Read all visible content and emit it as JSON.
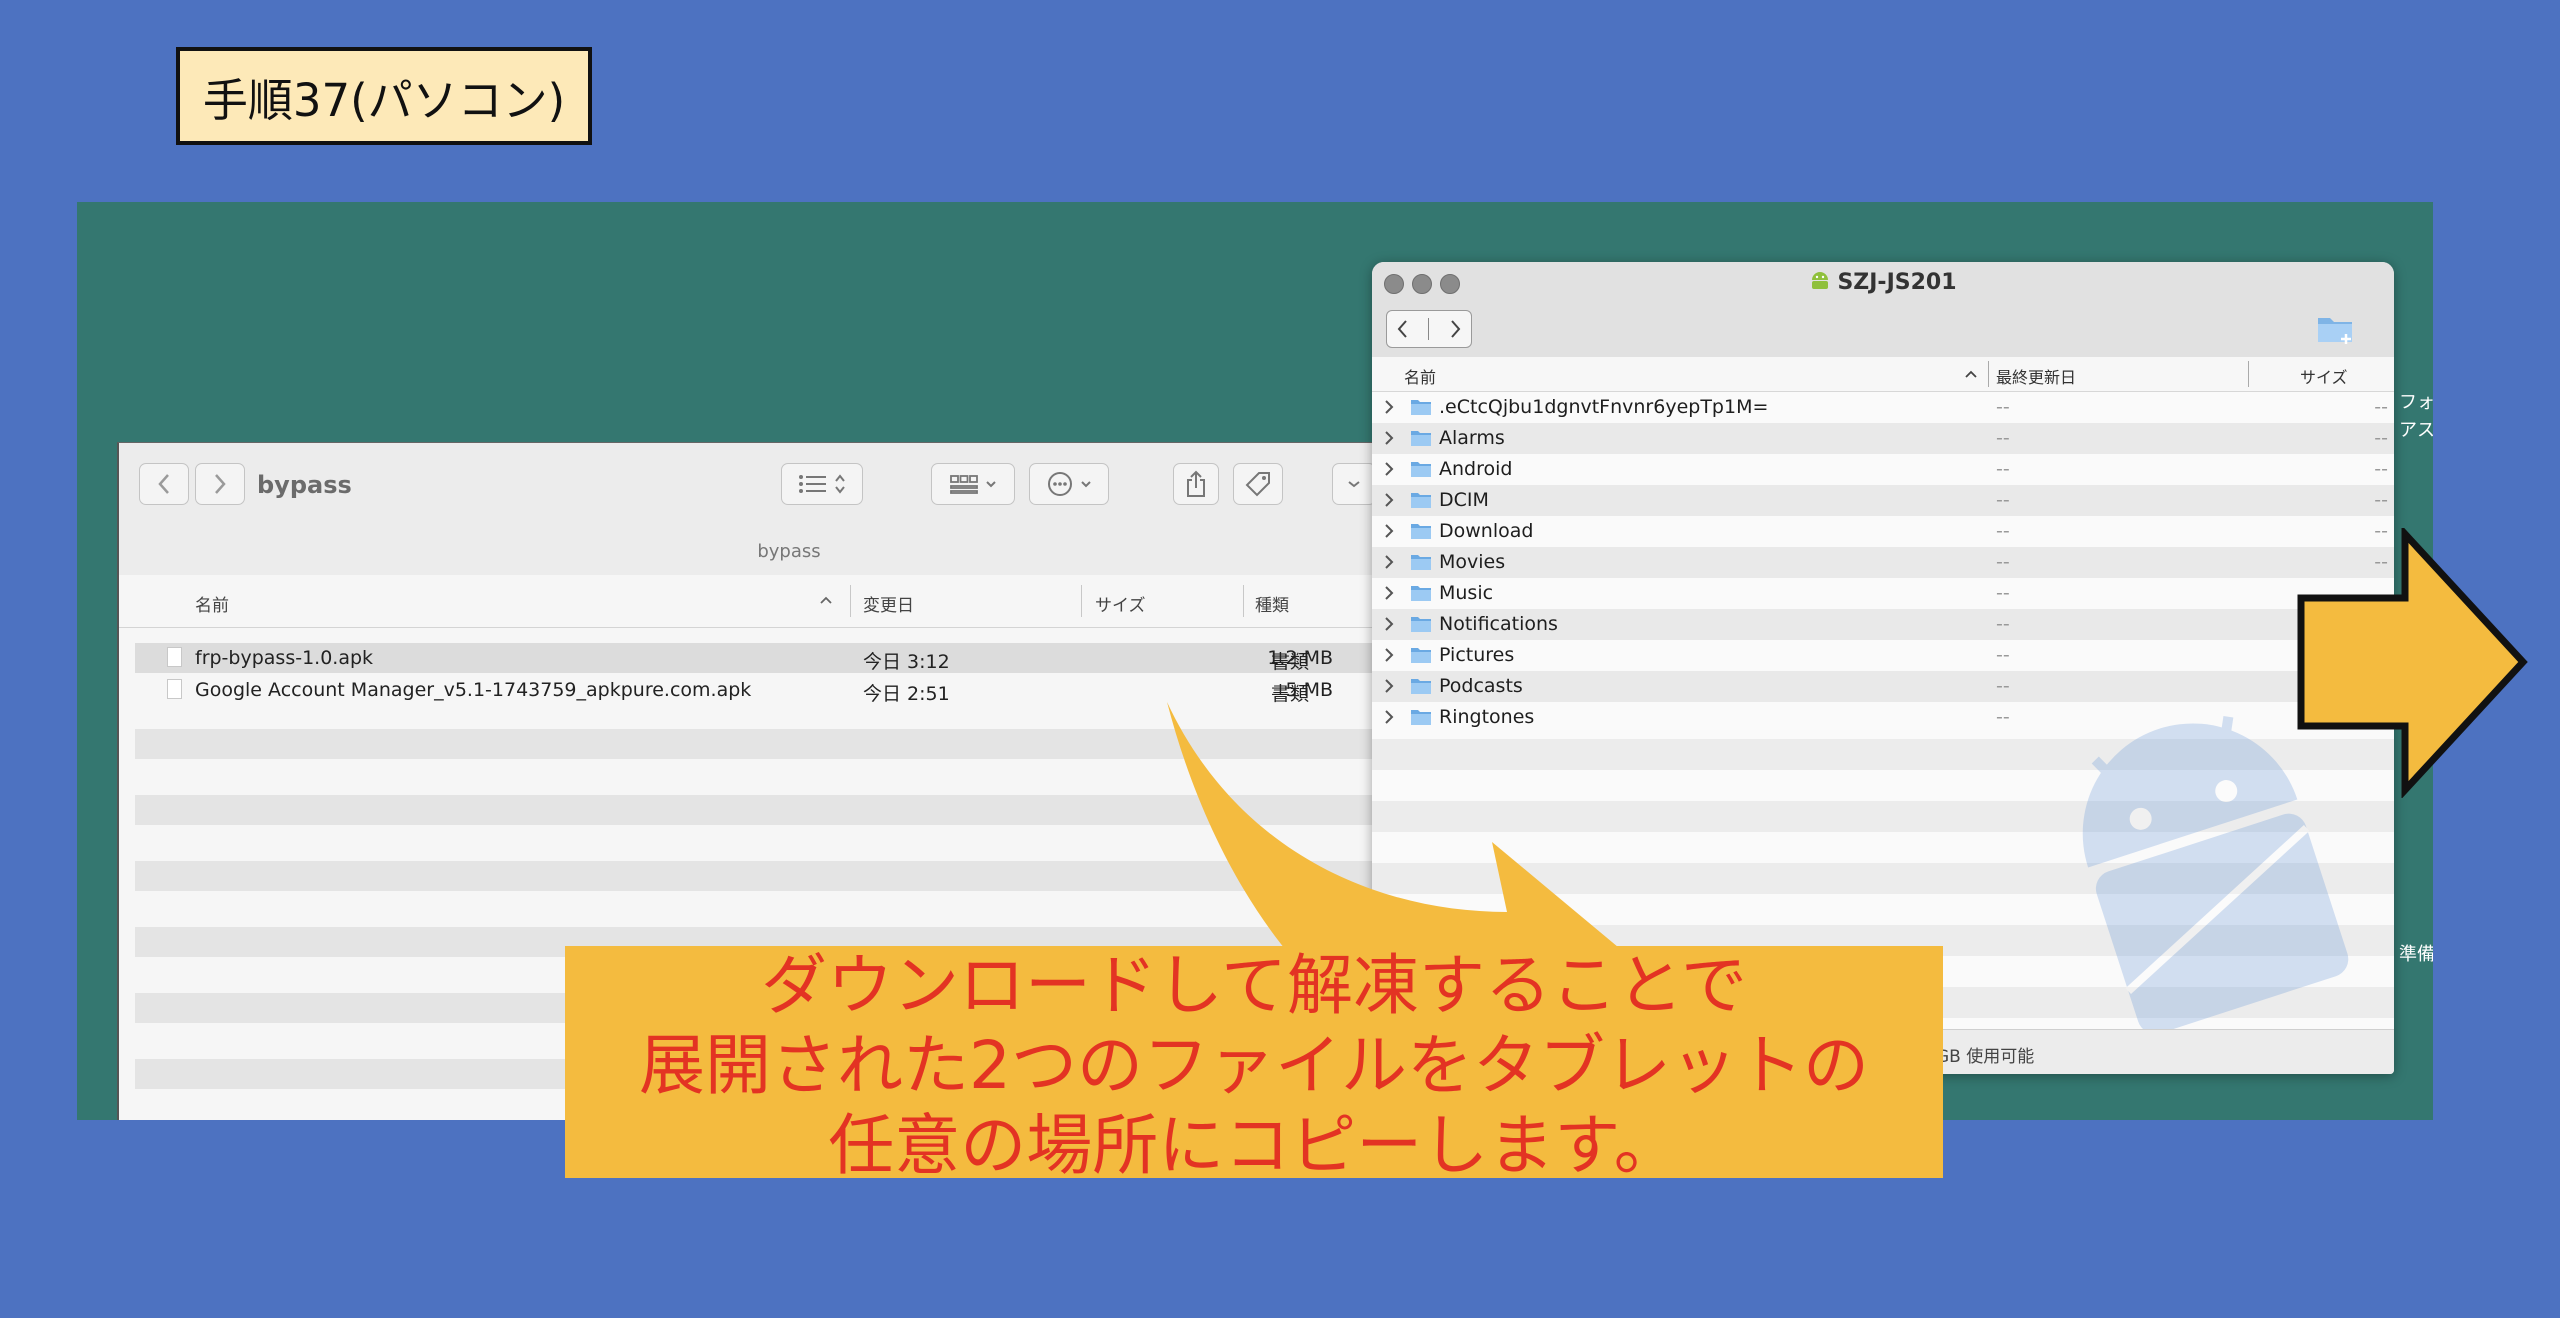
{
  "step_label": "手順37(パソコン)",
  "finder": {
    "title": "bypass",
    "path": "bypass",
    "columns": {
      "name": "名前",
      "modified": "変更日",
      "size": "サイズ",
      "kind": "種類"
    },
    "files": [
      {
        "name": "frp-bypass-1.0.apk",
        "modified": "今日 3:12",
        "size": "1.2 MB",
        "kind": "書類"
      },
      {
        "name": "Google Account Manager_v5.1-1743759_apkpure.com.apk",
        "modified": "今日 2:51",
        "size": "5 MB",
        "kind": "書類"
      }
    ]
  },
  "device": {
    "title": "SZJ-JS201",
    "columns": {
      "name": "名前",
      "modified": "最終更新日",
      "size": "サイズ"
    },
    "folders": [
      {
        "name": ".eCtcQjbu1dgnvtFnvnr6yepTp1M=",
        "modified": "--",
        "size": "--"
      },
      {
        "name": "Alarms",
        "modified": "--",
        "size": "--"
      },
      {
        "name": "Android",
        "modified": "--",
        "size": "--"
      },
      {
        "name": "DCIM",
        "modified": "--",
        "size": "--"
      },
      {
        "name": "Download",
        "modified": "--",
        "size": "--"
      },
      {
        "name": "Movies",
        "modified": "--",
        "size": "--"
      },
      {
        "name": "Music",
        "modified": "--",
        "size": ""
      },
      {
        "name": "Notifications",
        "modified": "--",
        "size": ""
      },
      {
        "name": "Pictures",
        "modified": "--",
        "size": ""
      },
      {
        "name": "Podcasts",
        "modified": "--",
        "size": ""
      },
      {
        "name": "Ringtones",
        "modified": "--",
        "size": ""
      }
    ],
    "status": "GB 使用可能"
  },
  "side_text": {
    "line1": "フォ",
    "line2": "アス",
    "line3": "準備"
  },
  "caption": {
    "line1": "ダウンロードして解凍することで",
    "line2": "展開された2つのファイルをタブレットの",
    "line3": "任意の場所にコピーします。"
  },
  "colors": {
    "background": "#4d72c1",
    "stage": "#347770",
    "accent_arrow": "#f4bb3f",
    "caption_text": "#e33323",
    "label_bg": "#fde9b8"
  }
}
